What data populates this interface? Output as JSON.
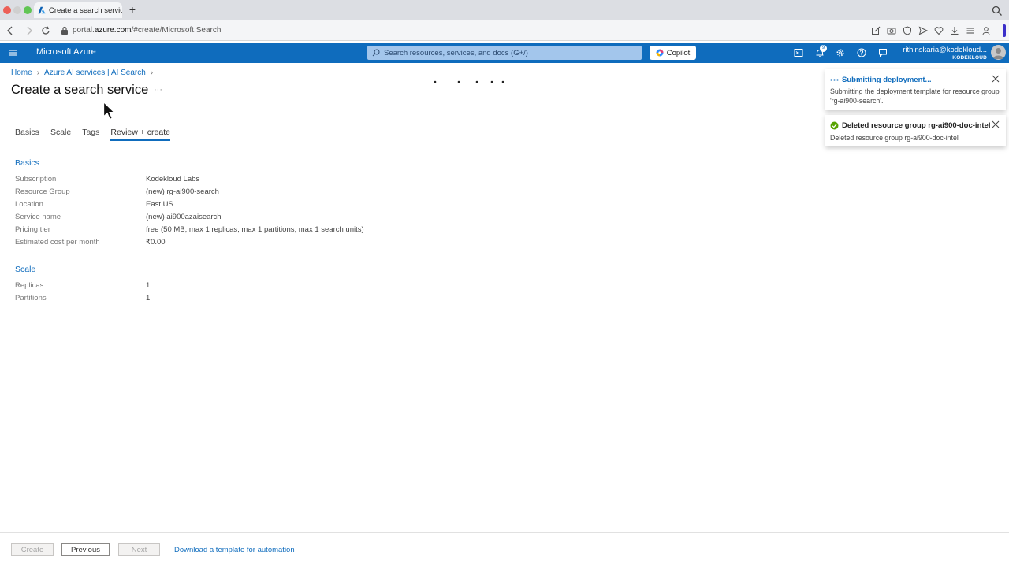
{
  "browser": {
    "tab_title": "Create a search service",
    "new_tab": "+",
    "url_prefix": "portal.",
    "url_domain": "azure.com",
    "url_path": "/#create/Microsoft.Search"
  },
  "azure_header": {
    "brand": "Microsoft Azure",
    "search_placeholder": "Search resources, services, and docs (G+/)",
    "copilot_label": "Copilot",
    "notification_count": "9",
    "user_email": "rithinskaria@kodekloud...",
    "user_org": "KODEKLOUD"
  },
  "breadcrumb": {
    "items": [
      "Home",
      "Azure AI services | AI Search"
    ]
  },
  "page": {
    "title": "Create a search service",
    "more": "···"
  },
  "tabs": {
    "items": [
      "Basics",
      "Scale",
      "Tags",
      "Review + create"
    ],
    "active": "Review + create"
  },
  "review": {
    "basics_title": "Basics",
    "basics": [
      {
        "label": "Subscription",
        "value": "Kodekloud Labs"
      },
      {
        "label": "Resource Group",
        "value": "(new) rg-ai900-search"
      },
      {
        "label": "Location",
        "value": "East US"
      },
      {
        "label": "Service name",
        "value": "(new) ai900azaisearch"
      },
      {
        "label": "Pricing tier",
        "value": "free (50 MB, max 1 replicas, max 1 partitions, max 1 search units)"
      },
      {
        "label": "Estimated cost per month",
        "value": "₹0.00"
      }
    ],
    "scale_title": "Scale",
    "scale": [
      {
        "label": "Replicas",
        "value": "1"
      },
      {
        "label": "Partitions",
        "value": "1"
      }
    ]
  },
  "notifications": [
    {
      "title": "Submitting deployment...",
      "body": "Submitting the deployment template for resource group 'rg-ai900-search'.",
      "status": "in-progress"
    },
    {
      "title": "Deleted resource group rg-ai900-doc-intel",
      "body": "Deleted resource group rg-ai900-doc-intel",
      "status": "success"
    }
  ],
  "footer": {
    "create_label": "Create",
    "previous_label": "Previous",
    "next_label": "Next",
    "template_link": "Download a template for automation"
  },
  "colors": {
    "azure_blue": "#0f6cbd",
    "success_green": "#57a300"
  }
}
